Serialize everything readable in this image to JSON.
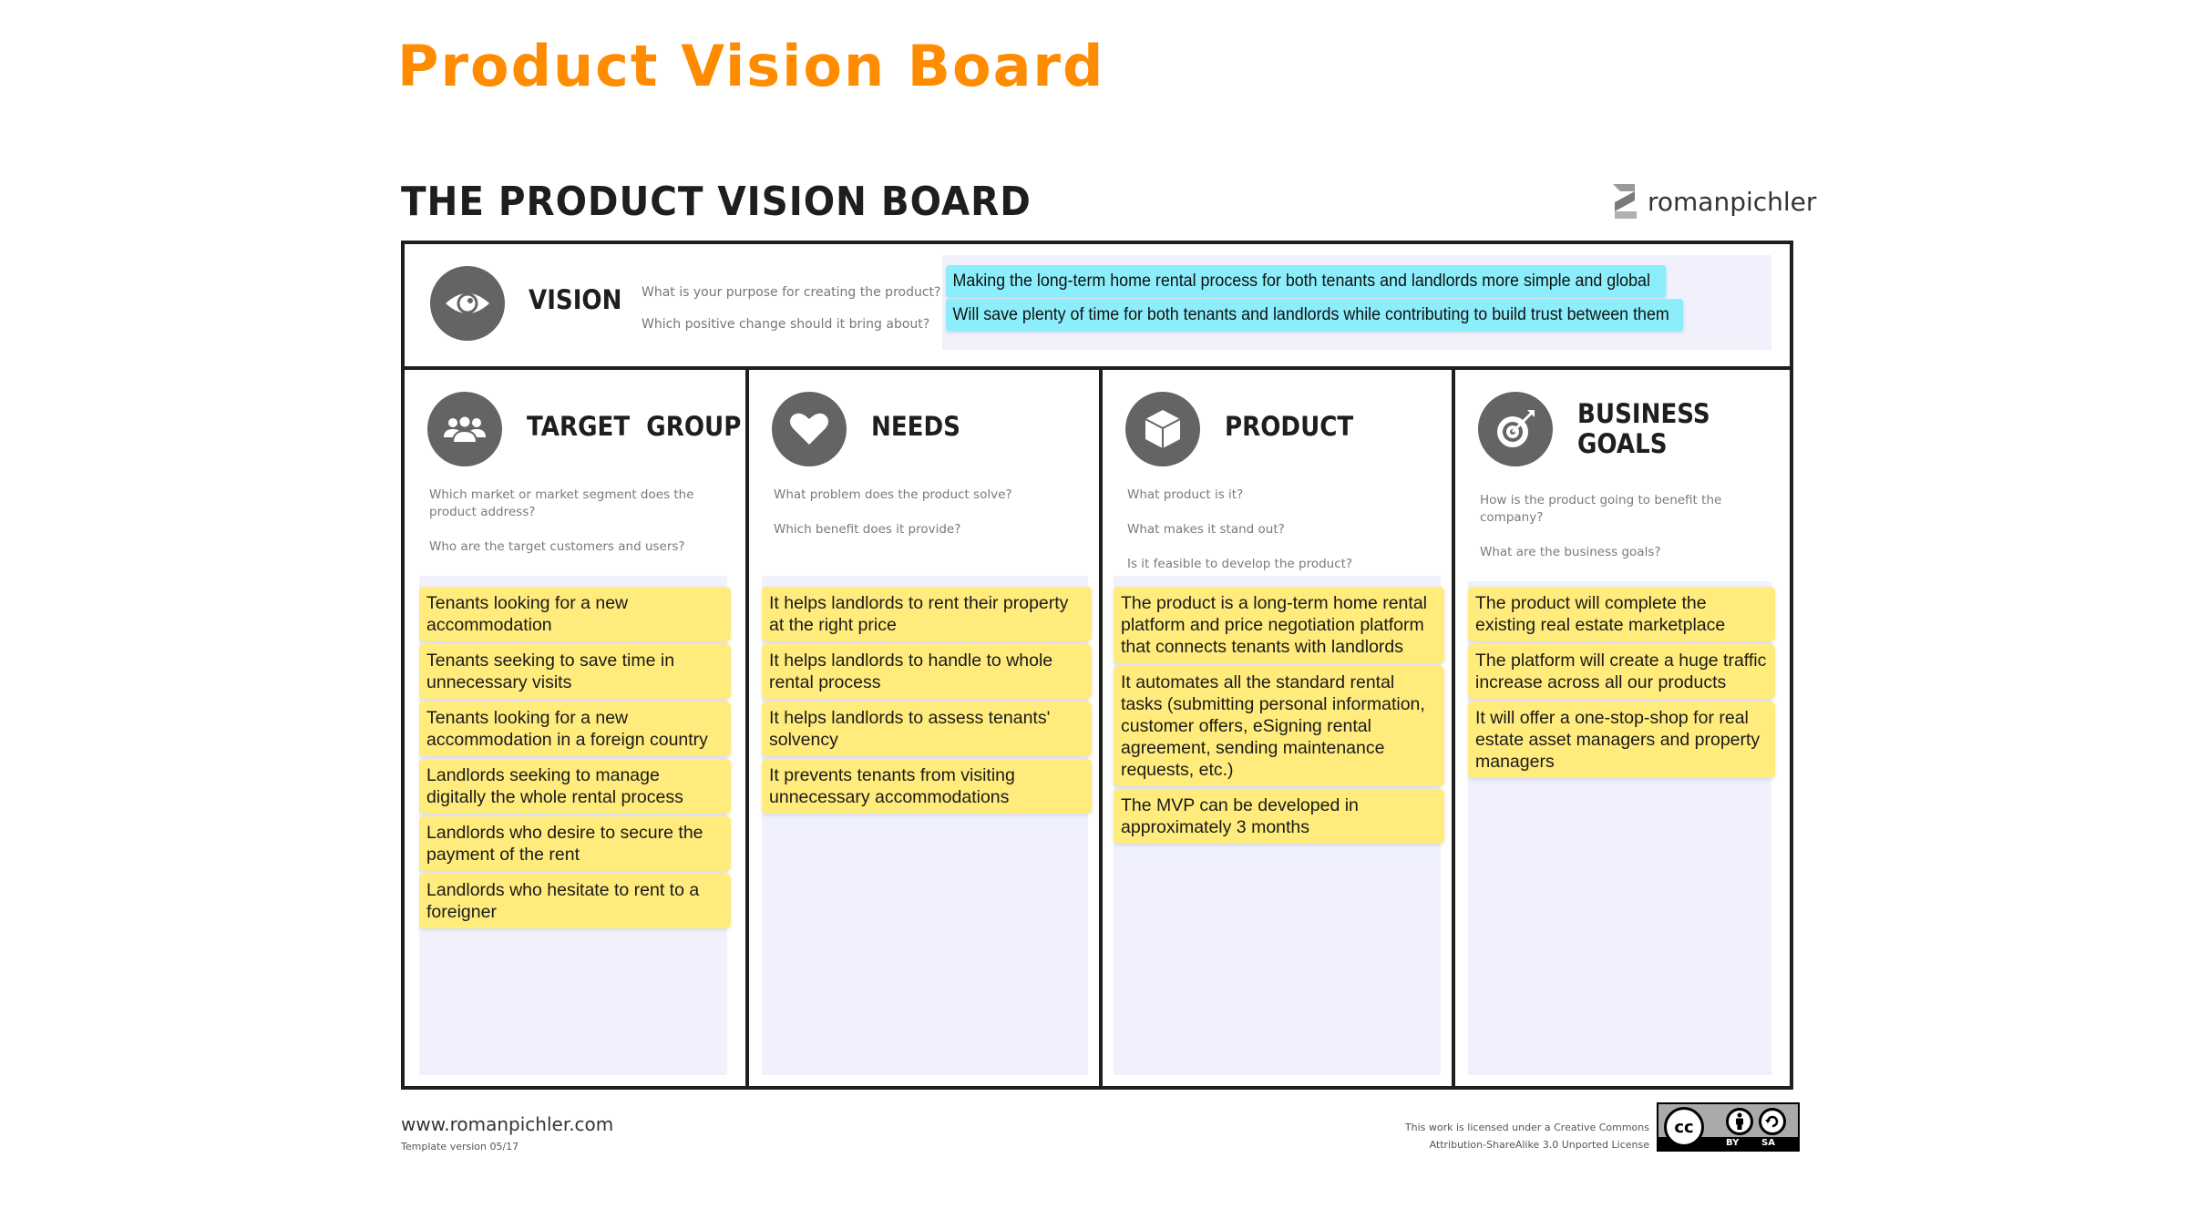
{
  "page_heading": "Product Vision Board",
  "board_title": "THE PRODUCT VISION BOARD",
  "brand": {
    "name": "romanpichler",
    "icon": "romanpichler-logo-icon"
  },
  "vision": {
    "label": "VISION",
    "icon": "eye-icon",
    "prompts": [
      "What is your purpose for creating the product?",
      "Which positive change should it bring about?"
    ],
    "stickies": [
      "Making the long-term home rental process for both tenants and landlords more simple and global",
      "Will save plenty of time for both tenants and landlords while contributing to build trust between them"
    ],
    "sticky_color": "#8CEEFB"
  },
  "columns": [
    {
      "title": "TARGET  GROUP",
      "icon": "people-group-icon",
      "prompts": [
        "Which market or market segment does the product address?",
        "Who are the target customers and users?"
      ],
      "stickies": [
        "Tenants looking for a new accommodation",
        "Tenants seeking to save time in unnecessary visits",
        "Tenants looking for a new accommodation in a foreign country",
        "Landlords seeking to manage digitally the whole rental process",
        "Landlords who desire to secure the payment of the rent",
        "Landlords who hesitate to rent to a foreigner"
      ]
    },
    {
      "title": "NEEDS",
      "icon": "heart-icon",
      "prompts": [
        "What problem does the product solve?",
        "Which benefit does it provide?"
      ],
      "stickies": [
        "It helps landlords to rent their property at the right price",
        "It helps landlords to handle to whole rental process",
        "It helps landlords to assess tenants' solvency",
        "It prevents tenants from visiting unnecessary accommodations"
      ]
    },
    {
      "title": "PRODUCT",
      "icon": "cube-icon",
      "prompts": [
        "What product is it?",
        "What makes it stand out?",
        "Is it feasible to develop the product?"
      ],
      "stickies": [
        "The product is a long-term home rental platform and price negotiation platform that connects tenants with landlords",
        "It automates all the standard rental tasks (submitting personal information, customer offers, eSigning rental agreement, sending maintenance requests, etc.)",
        "The MVP can be developed in approximately 3 months"
      ]
    },
    {
      "title_lines": [
        "BUSINESS",
        "GOALS"
      ],
      "title": "BUSINESS GOALS",
      "icon": "target-icon",
      "prompts": [
        "How is the product going to benefit the company?",
        "What are the business goals?"
      ],
      "stickies": [
        "The product will complete the existing real estate marketplace",
        "The platform will create a huge traffic increase across all our products",
        "It will offer a one-stop-shop for real estate asset managers and property managers"
      ]
    }
  ],
  "sticky_color": "#FFEC7C",
  "heading_color": "#FF8C00",
  "footer": {
    "url": "www.romanpichler.com",
    "version": "Template version 05/17",
    "license_lines": [
      "This work is licensed under a Creative Commons",
      "Attribution-ShareAlike 3.0 Unported License"
    ],
    "badge": {
      "main": "cc",
      "by": "BY",
      "sa": "SA"
    }
  }
}
